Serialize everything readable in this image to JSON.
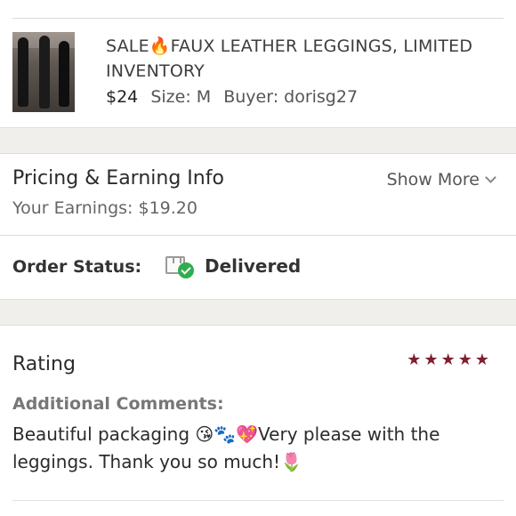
{
  "order_item": {
    "title": "SALE🔥FAUX LEATHER LEGGINGS, LIMITED INVENTORY",
    "price": "$24",
    "size": "Size: M",
    "buyer": "Buyer: dorisg27"
  },
  "pricing": {
    "title": "Pricing & Earning Info",
    "earnings": "Your Earnings: $19.20",
    "show_more": "Show More"
  },
  "order_status": {
    "label": "Order Status:",
    "value": "Delivered",
    "icon": "package-delivered-icon",
    "icon_color": "#2fae4e"
  },
  "rating": {
    "title": "Rating",
    "stars": 5,
    "star_color": "#7d1f2e",
    "comments_label": "Additional Comments:",
    "comments": "Beautiful packaging 😘🐾💖Very please with the leggings. Thank you so much!🌷"
  }
}
